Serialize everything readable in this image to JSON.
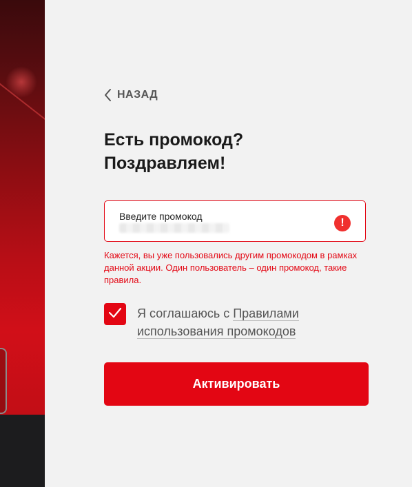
{
  "nav": {
    "back_label": "НАЗАД"
  },
  "heading": {
    "line1": "Есть промокод?",
    "line2": "Поздравляем!"
  },
  "promo": {
    "label": "Введите промокод",
    "value": "",
    "alert_icon_text": "!"
  },
  "error": {
    "message": "Кажется, вы уже пользовались другим промокодом в рамках данной акции. Один пользователь – один промокод, такие правила."
  },
  "agreement": {
    "checked": true,
    "text_prefix": "Я соглашаюсь с ",
    "link_text": "Правилами использования промокодов"
  },
  "actions": {
    "activate_label": "Активировать"
  },
  "colors": {
    "accent": "#e30613",
    "error": "#e30613",
    "alert_icon": "#f0302e"
  },
  "icons": {
    "back": "chevron-left-icon",
    "alert": "exclamation-circle-icon",
    "check": "checkmark-icon"
  }
}
